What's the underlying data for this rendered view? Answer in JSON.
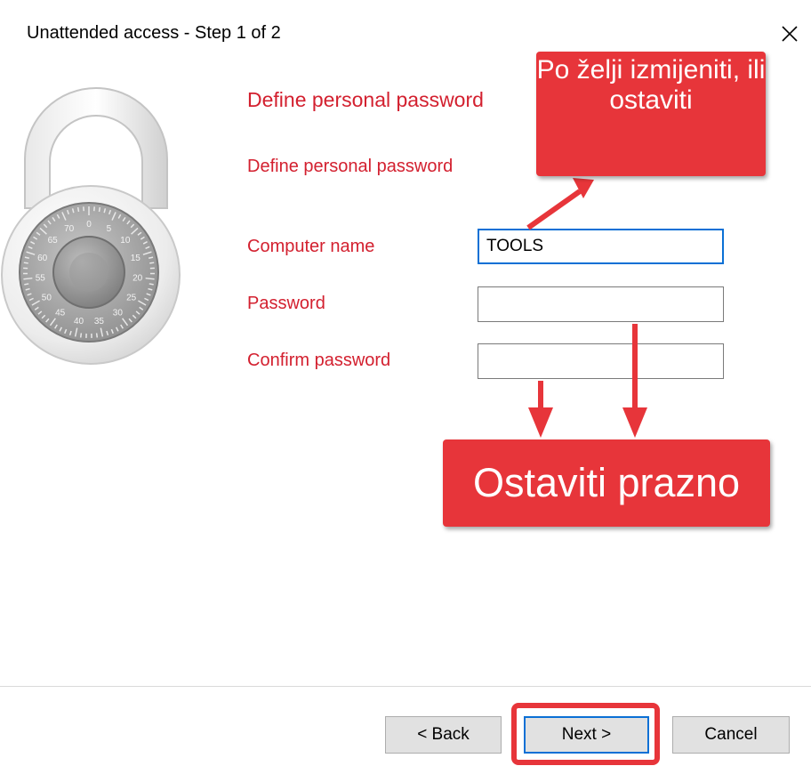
{
  "window": {
    "title": "Unattended access - Step 1 of 2",
    "close_glyph": "✕"
  },
  "header": {
    "title": "Define personal password",
    "subtitle": "Define personal password"
  },
  "form": {
    "computer_name_label": "Computer name",
    "computer_name_value": "TOOLS",
    "password_label": "Password",
    "password_value": "",
    "confirm_label": "Confirm password",
    "confirm_value": ""
  },
  "annotations": {
    "top_callout": "Po želji izmijeniti, ili ostaviti",
    "bottom_callout": "Ostaviti prazno",
    "callout_color": "#e7353a"
  },
  "buttons": {
    "back": "< Back",
    "next": "Next >",
    "cancel": "Cancel"
  },
  "lock_dial_numbers": [
    "0",
    "5",
    "10",
    "15",
    "20",
    "25",
    "30",
    "35",
    "40",
    "45",
    "50",
    "55",
    "60",
    "65",
    "70"
  ],
  "colors": {
    "label_red": "#d3202f",
    "focus_blue": "#0a70d5"
  }
}
